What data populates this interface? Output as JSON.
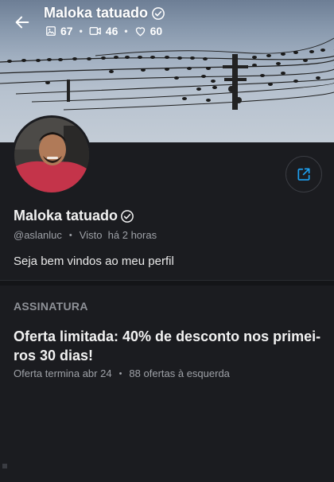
{
  "header": {
    "title": "Maloka tatuado",
    "stats": [
      {
        "icon": "image-icon",
        "value": "67"
      },
      {
        "icon": "video-icon",
        "value": "46"
      },
      {
        "icon": "heart-icon",
        "value": "60"
      }
    ]
  },
  "profile": {
    "name": "Maloka tatuado",
    "handle": "@aslanluc",
    "last_seen": "Visto  há 2 horas",
    "bio": "Seja bem vindos ao meu perfil"
  },
  "subscription": {
    "section_title": "ASSINATURA",
    "offer_text": "Oferta limitada: 40% de desconto nos primei-ros 30 dias!",
    "offer_ends": "Oferta termina abr 24",
    "offers_left": "88 ofertas à esquerda"
  },
  "colors": {
    "background": "#1b1c20",
    "accent": "#1da1f2",
    "muted_text": "#9ea1a7"
  }
}
